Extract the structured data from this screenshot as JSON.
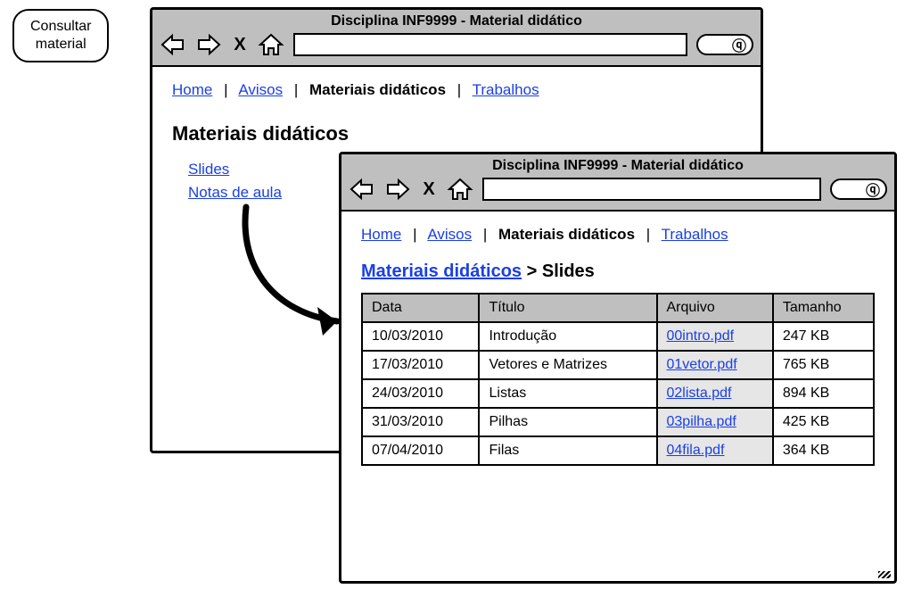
{
  "annotation": {
    "line1": "Consultar",
    "line2": "material"
  },
  "browser1": {
    "title": "Disciplina INF9999 - Material didático",
    "toolbar": {
      "x": "X",
      "search_glyph": "ⓠ"
    },
    "nav": {
      "home": "Home",
      "avisos": "Avisos",
      "materiais": "Materiais didáticos",
      "trabalhos": "Trabalhos",
      "sep": "|"
    },
    "page_title": "Materiais didáticos",
    "links": {
      "slides": "Slides",
      "notas": "Notas de aula"
    }
  },
  "browser2": {
    "title": "Disciplina INF9999 - Material didático",
    "toolbar": {
      "x": "X",
      "search_glyph": "ⓠ"
    },
    "nav": {
      "home": "Home",
      "avisos": "Avisos",
      "materiais": "Materiais didáticos",
      "trabalhos": "Trabalhos",
      "sep": "|"
    },
    "crumb": {
      "parent": "Materiais didáticos",
      "arrow": ">",
      "current": "Slides"
    },
    "table": {
      "headers": {
        "data": "Data",
        "titulo": "Título",
        "arquivo": "Arquivo",
        "tamanho": "Tamanho"
      },
      "rows": [
        {
          "data": "10/03/2010",
          "titulo": "Introdução",
          "arquivo": "00intro.pdf",
          "tamanho": "247 KB"
        },
        {
          "data": "17/03/2010",
          "titulo": "Vetores e Matrizes",
          "arquivo": "01vetor.pdf",
          "tamanho": "765 KB"
        },
        {
          "data": "24/03/2010",
          "titulo": "Listas",
          "arquivo": "02lista.pdf",
          "tamanho": "894 KB"
        },
        {
          "data": "31/03/2010",
          "titulo": "Pilhas",
          "arquivo": "03pilha.pdf",
          "tamanho": "425 KB"
        },
        {
          "data": "07/04/2010",
          "titulo": "Filas",
          "arquivo": "04fila.pdf",
          "tamanho": "364 KB"
        }
      ]
    }
  }
}
